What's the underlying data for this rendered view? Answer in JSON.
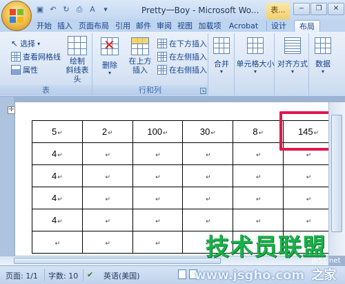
{
  "title_bar": {
    "doc_title": "Pretty一Boy - Microsoft Wo...",
    "context_title": "表...",
    "quick_access": [
      "save-icon",
      "undo-icon",
      "redo-icon",
      "print-preview-icon",
      "spelling-icon",
      "customize-icon"
    ],
    "window_buttons": [
      "−",
      "❐",
      "✕"
    ]
  },
  "tabs": [
    {
      "label": "开始"
    },
    {
      "label": "插入"
    },
    {
      "label": "页面布局"
    },
    {
      "label": "引用"
    },
    {
      "label": "邮件"
    },
    {
      "label": "审阅"
    },
    {
      "label": "视图"
    },
    {
      "label": "加载项"
    },
    {
      "label": "Acrobat"
    },
    {
      "label": "设计"
    },
    {
      "label": "布局",
      "active": true
    }
  ],
  "ribbon": {
    "group_table": {
      "label": "表",
      "select": "选择",
      "view_gridlines": "查看网格线",
      "properties": "属性",
      "draw_diagonal": "绘制\n斜线表头"
    },
    "group_rows_cols": {
      "label": "行和列",
      "delete": "删除",
      "insert_above": "在上方\n插入",
      "insert_below": "在下方插入",
      "insert_left": "在左侧插入",
      "insert_right": "在右侧插入"
    },
    "merge": "合并",
    "cell_size": "单元格大小",
    "alignment": "对齐方式",
    "data": "数据"
  },
  "table": {
    "rows": [
      [
        "5",
        "2",
        "100",
        "30",
        "8",
        "145"
      ],
      [
        "4",
        "",
        "",
        "",
        "",
        ""
      ],
      [
        "4",
        "",
        "",
        "",
        "",
        ""
      ],
      [
        "4",
        "",
        "",
        "",
        "",
        ""
      ],
      [
        "4",
        "",
        "",
        "",
        "",
        ""
      ],
      [
        "",
        "",
        "",
        "",
        "",
        ""
      ]
    ],
    "cell_marker": "↵",
    "highlight_color": "#e0174e"
  },
  "status_bar": {
    "page": "页面: 1/1",
    "words": "字数: 10",
    "language": "英语(美国)"
  },
  "watermark": {
    "main": "技术员联盟",
    "url": "www.jsgho.com",
    "site": "jb51.net",
    "home": "之家"
  }
}
